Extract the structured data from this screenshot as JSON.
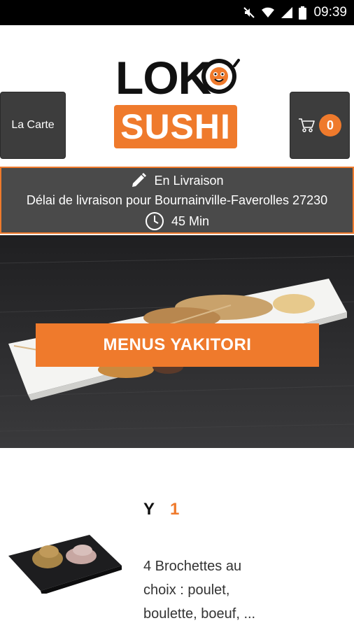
{
  "status": {
    "time": "09:39",
    "icons": [
      "mute-icon",
      "wifi-icon",
      "signal-icon",
      "battery-icon"
    ]
  },
  "header": {
    "menu_label": "La Carte",
    "cart_count": "0",
    "logo_top": "LOK",
    "logo_bottom": "SUSHI"
  },
  "delivery": {
    "mode": "En Livraison",
    "location": "Délai de livraison pour Bournainville-Faverolles 27230",
    "time": "45 Min"
  },
  "hero": {
    "button_label": "MENUS YAKITORI"
  },
  "product": {
    "name": "Y",
    "quantity": "1",
    "description": "4 Brochettes au choix : poulet, boulette, boeuf, ..."
  },
  "colors": {
    "accent": "#ef7a2c",
    "dark_button": "#3d3d3d",
    "banner_bg": "#4a4a4a"
  }
}
